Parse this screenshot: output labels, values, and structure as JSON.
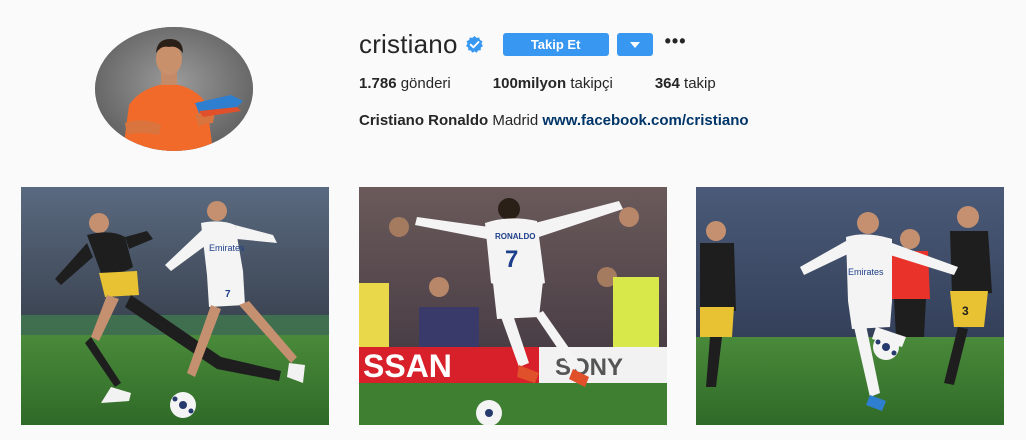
{
  "profile": {
    "username": "cristiano",
    "follow_label": "Takip Et",
    "more_label": "•••",
    "stats": [
      {
        "value": "1.786",
        "label": "gönderi"
      },
      {
        "value": "100milyon",
        "label": "takipçi"
      },
      {
        "value": "364",
        "label": "takip"
      }
    ],
    "bio": {
      "full_name": "Cristiano Ronaldo",
      "text": "Madrid",
      "link": "www.facebook.com/cristiano"
    }
  },
  "posts": [
    {
      "shirt_text": "Emirates",
      "player_number": "7"
    },
    {
      "shirt_text": "RONALDO",
      "player_number": "7",
      "banner_text": "SSAN",
      "sponsor_text": "SONY"
    },
    {
      "shirt_text": "Emirates",
      "opponent_number": "3"
    }
  ],
  "colors": {
    "accent": "#3897f0",
    "background": "#fafafa",
    "link": "#003569"
  }
}
